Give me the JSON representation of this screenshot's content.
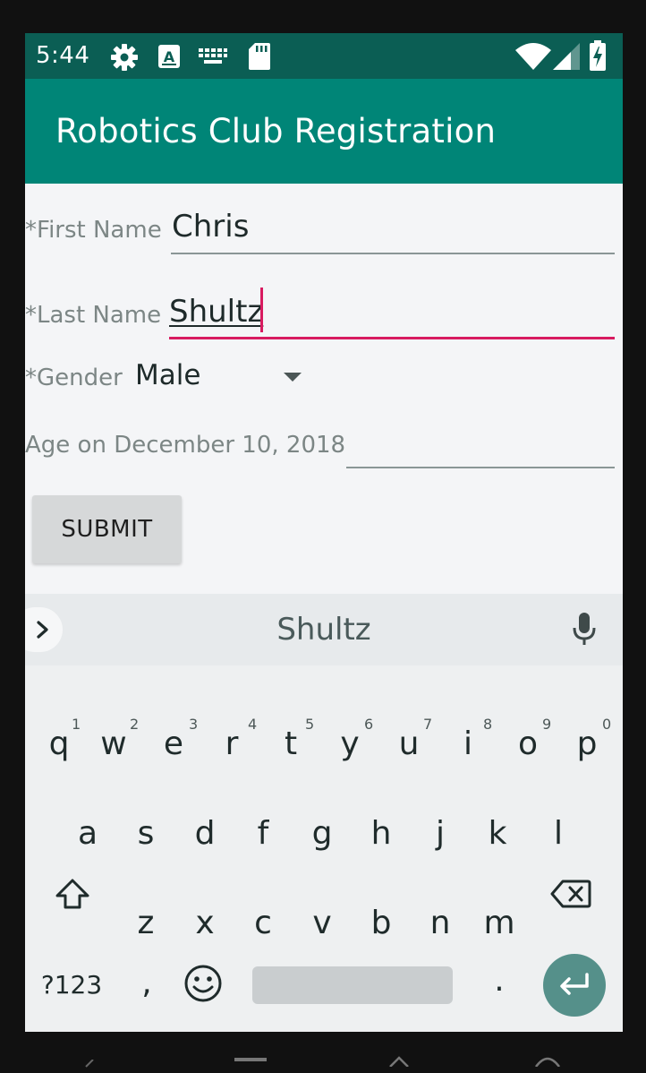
{
  "status_bar": {
    "time": "5:44",
    "icons": [
      "settings-icon",
      "a-notification-icon",
      "keyboard-icon",
      "sd-card-icon",
      "wifi-icon",
      "signal-icon",
      "battery-charging-icon"
    ]
  },
  "app_bar": {
    "title": "Robotics Club Registration",
    "color": "#008577"
  },
  "form": {
    "first_name": {
      "label": "*First Name",
      "value": "Chris"
    },
    "last_name": {
      "label": "*Last Name",
      "value": "Shultz"
    },
    "gender": {
      "label": "*Gender",
      "value": "Male"
    },
    "age": {
      "label": "Age on December 10, 2018",
      "value": ""
    },
    "submit_label": "SUBMIT",
    "accent_color": "#d81b60"
  },
  "keyboard": {
    "suggestion": "Shultz",
    "row1": [
      "q",
      "w",
      "e",
      "r",
      "t",
      "y",
      "u",
      "i",
      "o",
      "p"
    ],
    "row1_hints": [
      "1",
      "2",
      "3",
      "4",
      "5",
      "6",
      "7",
      "8",
      "9",
      "0"
    ],
    "row2": [
      "a",
      "s",
      "d",
      "f",
      "g",
      "h",
      "j",
      "k",
      "l"
    ],
    "row3": [
      "z",
      "x",
      "c",
      "v",
      "b",
      "n",
      "m"
    ],
    "symbols_label": "?123",
    "comma": ",",
    "period": ".",
    "icons": [
      "chevron-right-icon",
      "microphone-icon",
      "shift-icon",
      "backspace-icon",
      "emoji-icon",
      "enter-icon"
    ]
  }
}
